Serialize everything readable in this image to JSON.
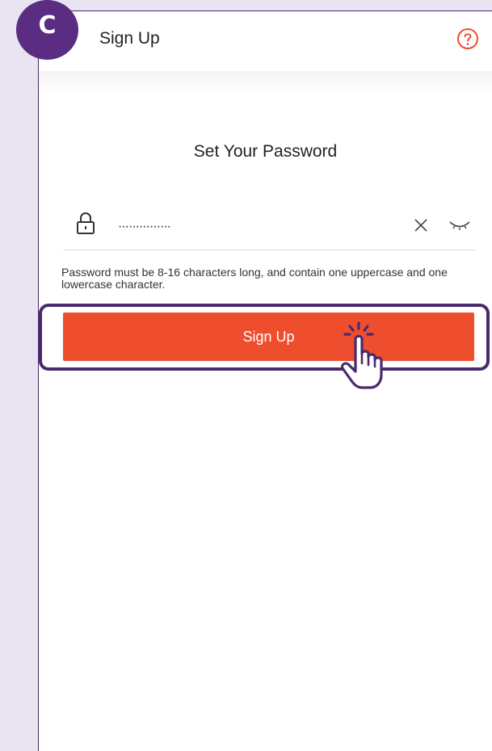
{
  "step_badge": "C",
  "header": {
    "title": "Sign Up",
    "help_icon": "help-circle-icon"
  },
  "page": {
    "heading": "Set Your Password"
  },
  "password_field": {
    "value": "···············",
    "lock_icon": "lock-icon",
    "clear_icon": "close-icon",
    "visibility_icon": "eye-closed-icon"
  },
  "hint": "Password must be 8-16 characters long, and contain one uppercase and one lowercase character.",
  "signup_button": {
    "label": "Sign Up"
  },
  "colors": {
    "accent": "#ef4e2e",
    "brand_purple": "#5a2c82",
    "highlight_border": "#4a2a6b",
    "background": "#e9e4f1"
  }
}
